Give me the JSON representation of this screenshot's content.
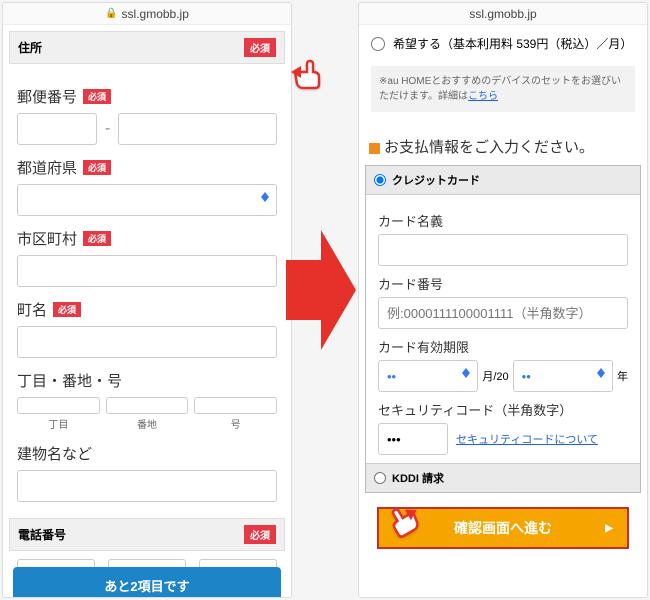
{
  "url": "ssl.gmobb.jp",
  "left": {
    "sections": {
      "address": {
        "title": "住所",
        "required": "必須"
      },
      "phone": {
        "title": "電話番号",
        "required": "必須"
      }
    },
    "fields": {
      "zip": {
        "label": "郵便番号",
        "required": "必須"
      },
      "pref": {
        "label": "都道府県",
        "required": "必須"
      },
      "city": {
        "label": "市区町村",
        "required": "必須"
      },
      "town": {
        "label": "町名",
        "required": "必須"
      },
      "block": {
        "label": "丁目・番地・号",
        "sub1": "丁目",
        "sub2": "番地",
        "sub3": "号"
      },
      "building": {
        "label": "建物名など"
      }
    },
    "banner": "あと2項目です"
  },
  "right": {
    "option": {
      "label": "希望する（基本利用料 539円（税込）／月）"
    },
    "note": {
      "text": "※au HOMEとおすすめのデバイスのセットをお選びいただけます。詳細は",
      "link": "こちら"
    },
    "payTitle": "お支払情報をご入力ください。",
    "pay": {
      "credit": {
        "label": "クレジットカード"
      },
      "cardName": {
        "label": "カード名義"
      },
      "cardNo": {
        "label": "カード番号",
        "placeholder": "例:0000111100001111（半角数字）"
      },
      "expiry": {
        "label": "カード有効期限",
        "monthSuffix": "月/20",
        "yearSuffix": "年",
        "monthVal": "••",
        "yearVal": "••"
      },
      "sec": {
        "label": "セキュリティコード（半角数字）",
        "value": "•••",
        "link": "セキュリティコードについて"
      },
      "kddi": {
        "label": "KDDI 請求"
      }
    },
    "submit": "確認画面へ進む"
  }
}
